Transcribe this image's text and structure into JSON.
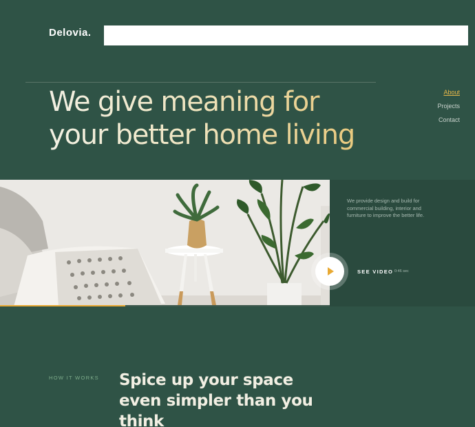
{
  "brand": {
    "logo": "Delovia."
  },
  "search": {
    "value": ""
  },
  "hero": {
    "title": "We give meaning for your better home living"
  },
  "nav": {
    "items": [
      {
        "label": "About",
        "active": true
      },
      {
        "label": "Projects",
        "active": false
      },
      {
        "label": "Contact",
        "active": false
      }
    ]
  },
  "media": {
    "description": "We provide design and build for commercial building, interior and furniture to improve the better life.",
    "see_video_label": "SEE VIDEO",
    "duration": "0:46 sec",
    "progress": 0.38
  },
  "how_it_works": {
    "label": "HOW IT WORKS",
    "title": "Spice up your space even simpler than you think"
  },
  "colors": {
    "background": "#2f5346",
    "panel": "#2a4a3e",
    "accent": "#e8a933",
    "heading_gold": "#e8c677",
    "heading_cream": "#f3f1e4"
  },
  "icons": {
    "play": "play-icon"
  }
}
